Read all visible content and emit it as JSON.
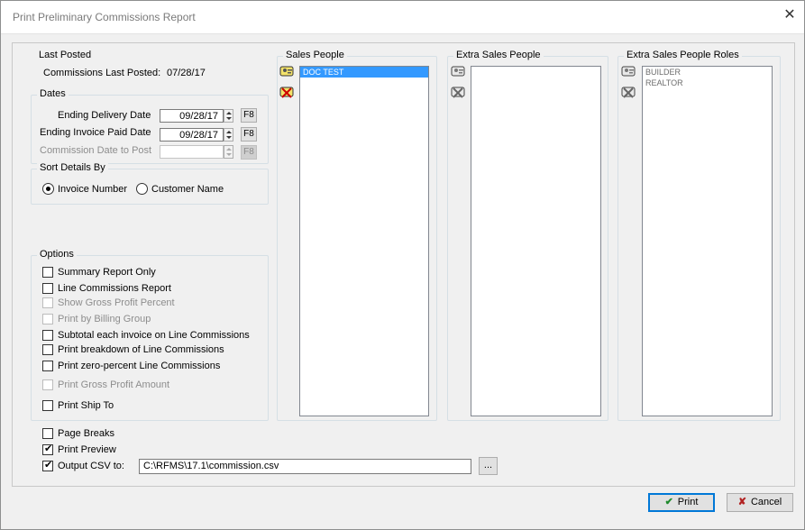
{
  "window": {
    "title": "Print Preliminary Commissions Report",
    "close_glyph": "✕"
  },
  "last_posted": {
    "legend": "Last Posted",
    "label": "Commissions Last Posted:",
    "value": "07/28/17"
  },
  "dates": {
    "legend": "Dates",
    "ending_delivery": {
      "label": "Ending Delivery Date",
      "value": "09/28/17",
      "key": "F8"
    },
    "ending_invoice": {
      "label": "Ending Invoice Paid Date",
      "value": "09/28/17",
      "key": "F8"
    },
    "commission_post": {
      "label": "Commission Date to Post",
      "value": "",
      "key": "F8"
    }
  },
  "sort": {
    "legend": "Sort Details By",
    "invoice_number": "Invoice Number",
    "customer_name": "Customer Name",
    "selected": "invoice_number"
  },
  "options": {
    "legend": "Options",
    "summary_only": {
      "label": "Summary Report Only",
      "checked": false,
      "enabled": true
    },
    "line_commissions": {
      "label": "Line Commissions Report",
      "checked": false,
      "enabled": true
    },
    "gross_profit_pct": {
      "label": "Show Gross Profit Percent",
      "checked": false,
      "enabled": false
    },
    "billing_group": {
      "label": "Print by Billing Group",
      "checked": false,
      "enabled": false
    },
    "subtotal_invoice": {
      "label": "Subtotal each invoice on Line Commissions",
      "checked": false,
      "enabled": true
    },
    "breakdown": {
      "label": "Print breakdown of Line Commissions",
      "checked": false,
      "enabled": true
    },
    "zero_percent": {
      "label": "Print zero-percent Line Commissions",
      "checked": false,
      "enabled": true
    },
    "gross_profit_amt": {
      "label": "Print Gross Profit Amount",
      "checked": false,
      "enabled": false
    },
    "ship_to": {
      "label": "Print Ship To",
      "checked": false,
      "enabled": true
    }
  },
  "bottom": {
    "page_breaks": {
      "label": "Page Breaks",
      "checked": false
    },
    "print_preview": {
      "label": "Print Preview",
      "checked": true
    },
    "output_csv": {
      "label": "Output CSV to:",
      "checked": true,
      "path": "C:\\RFMS\\17.1\\commission.csv",
      "browse": "..."
    }
  },
  "sales_people": {
    "legend": "Sales People",
    "items": [
      "DOC TEST"
    ],
    "selected": "DOC TEST"
  },
  "extra_sales_people": {
    "legend": "Extra Sales People",
    "items": []
  },
  "extra_roles": {
    "legend": "Extra Sales People Roles",
    "items": [
      "BUILDER",
      "REALTOR"
    ]
  },
  "buttons": {
    "print": "Print",
    "cancel": "Cancel",
    "check_glyph": "✔",
    "x_glyph": "✘"
  },
  "colors": {
    "selection": "#3399ff",
    "default_border": "#0078d7",
    "print_icon": "#1f8a2c",
    "cancel_icon": "#b22222"
  }
}
